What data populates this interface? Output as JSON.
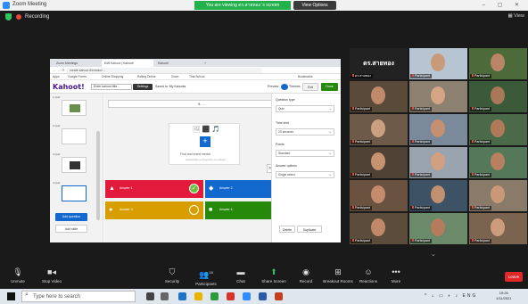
{
  "window": {
    "title": "Zoom Meeting",
    "banner": "You are viewing ดร.สายทอง 's screen",
    "view_options": "View Options",
    "controls": "–  ▢  ✕"
  },
  "meeting": {
    "recording_label": "Recording",
    "view_label": "View"
  },
  "shared_screen": {
    "chrome_tabs": [
      {
        "label": "Zoom Meetings"
      },
      {
        "label": "Edit Kahoot | Kahoot!"
      },
      {
        "label": "Kahoot!"
      },
      {
        "label": "+"
      }
    ],
    "address": "create.kahoot.it/creator/…",
    "bookmarks": [
      "Apps",
      "Google Forms",
      "Online Shopping",
      "Rolling Online",
      "Zoom",
      "Thai School",
      "Bookmarks"
    ],
    "kahoot": {
      "logo": "Kahoot!",
      "title_placeholder": "Enter kahoot title...",
      "settings_label": "Settings",
      "saved_label": "Saved to: My Kahoots",
      "preview_label": "Preview",
      "themes_label": "Themes",
      "exit_label": "Exit",
      "done_label": "Done",
      "question_list": [
        {
          "label": "1  Quiz"
        },
        {
          "label": "2  Quiz"
        },
        {
          "label": "3  Quiz"
        },
        {
          "label": "4  Quiz"
        }
      ],
      "add_question": "Add question",
      "add_slide": "Add slide",
      "question_text": "5. ...",
      "media_icons": "🖼 ⬛ 🎵",
      "media_plus": "+",
      "media_text": "Find and insert media",
      "media_subtext": "Upload file or drag here to upload",
      "answers": [
        {
          "shape": "▲",
          "text": "Answer 1",
          "color": "#e21b3c",
          "correct": true
        },
        {
          "shape": "◆",
          "text": "Answer 2",
          "color": "#1368ce",
          "correct": false
        },
        {
          "shape": "●",
          "text": "Answer 3",
          "color": "#d89e00",
          "correct": false
        },
        {
          "shape": "■",
          "text": "Answer 4",
          "color": "#26890c",
          "correct": false
        }
      ],
      "question_type_label": "Question type",
      "question_type_value": "Quiz",
      "time_limit_label": "Time limit",
      "time_limit_value": "20 seconds",
      "points_label": "Points",
      "points_value": "Standard",
      "answer_options_label": "Answer options",
      "answer_options_value": "Single select",
      "delete_label": "Delete",
      "duplicate_label": "Duplicate",
      "collapse_icon": ">"
    }
  },
  "gallery": {
    "participants": [
      {
        "name": "ดร.สายทอง",
        "bg": "#222222",
        "initials": "ดร.สายทอง"
      },
      {
        "name": "Participant",
        "bg": "#b7c4d2",
        "skin": "#c99a7a"
      },
      {
        "name": "Participant",
        "bg": "#4d6b3a",
        "skin": "#b88566"
      },
      {
        "name": "Participant",
        "bg": "#5a4a3a",
        "skin": "#c08a6a"
      },
      {
        "name": "Participant",
        "bg": "#8c8070",
        "skin": "#d4a585"
      },
      {
        "name": "Participant",
        "bg": "#3a5a3a",
        "skin": "#a87858"
      },
      {
        "name": "Participant",
        "bg": "#6e5a48",
        "skin": "#caa080"
      },
      {
        "name": "Participant",
        "bg": "#7a8a9a",
        "skin": "#c49070"
      },
      {
        "name": "Participant",
        "bg": "#4a6a4a",
        "skin": "#b07a5a"
      },
      {
        "name": "Participant",
        "bg": "#4f4336",
        "skin": "#c69270"
      },
      {
        "name": "Participant",
        "bg": "#9aa4ae",
        "skin": "#d0a080"
      },
      {
        "name": "Participant",
        "bg": "#55775a",
        "skin": "#b88060"
      },
      {
        "name": "Participant",
        "bg": "#6a5240",
        "skin": "#c48c6c"
      },
      {
        "name": "Participant",
        "bg": "#3e5266",
        "skin": "#c09070"
      },
      {
        "name": "Participant",
        "bg": "#8a7a6a",
        "skin": "#c89878"
      },
      {
        "name": "Participant",
        "bg": "#5c4c3c",
        "skin": "#c08868"
      },
      {
        "name": "Participant",
        "bg": "#6a8a6a",
        "skin": "#b47c5c"
      },
      {
        "name": "Participant",
        "bg": "#7a6450",
        "skin": "#cc9c7c"
      }
    ],
    "chevron": "⌄"
  },
  "toolbar": {
    "unmute": "Unmute",
    "stop_video": "Stop Video",
    "security": "Security",
    "participants": "Participants",
    "participants_count": "18",
    "chat": "Chat",
    "share_screen": "Share Screen",
    "record": "Record",
    "breakout": "Breakout Rooms",
    "reactions": "Reactions",
    "more": "More",
    "leave": "Leave"
  },
  "taskbar": {
    "search_placeholder": "Type here to search",
    "tray_icons": "^ ⌂ ▭ ◐ ♪ ENG",
    "time": "10:26",
    "date": "1/11/2021"
  }
}
